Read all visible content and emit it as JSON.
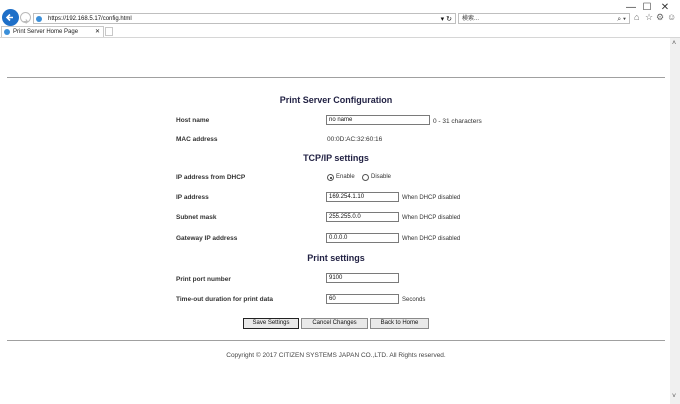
{
  "browser": {
    "address": "https://192.168.5.17/config.html",
    "search_placeholder": "検索...",
    "tab_title": "Print Server Home Page",
    "window_controls": [
      "—",
      "☐",
      "✕"
    ],
    "tool_icons": [
      "home-icon",
      "star-icon",
      "gear-icon",
      "smiley-icon"
    ]
  },
  "page": {
    "title": "Print Server Configuration",
    "host_name": {
      "label": "Host name",
      "value": "no name",
      "hint": "0 - 31 characters"
    },
    "mac": {
      "label": "MAC address",
      "value": "00:0D:AC:32:60:16"
    },
    "tcpip_heading": "TCP/IP settings",
    "dhcp": {
      "label": "IP address from DHCP",
      "enable": "Enable",
      "disable": "Disable",
      "selected": "Enable"
    },
    "ip": {
      "label": "IP address",
      "value": "169.254.1.10",
      "hint": "When DHCP disabled"
    },
    "subnet": {
      "label": "Subnet mask",
      "value": "255.255.0.0",
      "hint": "When DHCP disabled"
    },
    "gateway": {
      "label": "Gateway IP address",
      "value": "0.0.0.0",
      "hint": "When DHCP disabled"
    },
    "print_heading": "Print settings",
    "port": {
      "label": "Print port number",
      "value": "9100"
    },
    "timeout": {
      "label": "Time-out duration for print data",
      "value": "60",
      "unit": "Seconds"
    },
    "buttons": {
      "save": "Save Settings",
      "cancel": "Cancel Changes",
      "home": "Back to Home"
    },
    "copyright": "Copyright © 2017 CITIZEN SYSTEMS JAPAN CO.,LTD. All Rights reserved."
  }
}
